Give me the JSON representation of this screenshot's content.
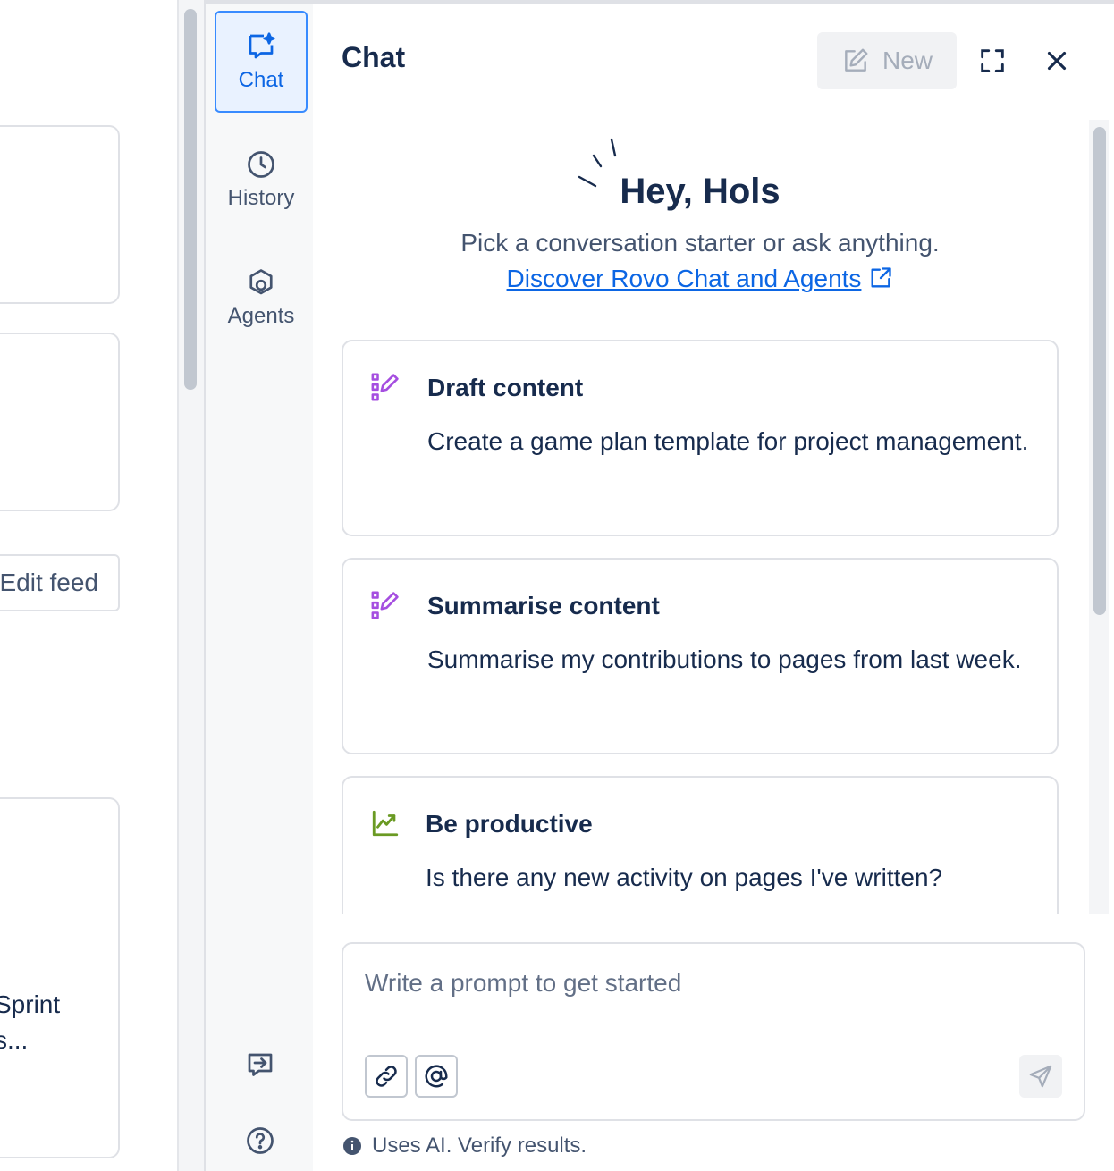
{
  "background": {
    "edit_feed_label": "Edit feed",
    "card_text_line1": "Sprint",
    "card_text_line2": "s..."
  },
  "rail": {
    "items": [
      {
        "label": "Chat",
        "icon": "chat-sparkle-icon",
        "active": true
      },
      {
        "label": "History",
        "icon": "clock-icon",
        "active": false
      },
      {
        "label": "Agents",
        "icon": "agents-icon",
        "active": false
      }
    ],
    "bottom_icons": [
      "switch-to-panel-icon",
      "help-icon"
    ]
  },
  "panel": {
    "title": "Chat",
    "new_button": "New",
    "greeting": "Hey, Hols",
    "subtext": "Pick a conversation starter or ask anything.",
    "discover_link": "Discover Rovo Chat and Agents",
    "starters": [
      {
        "icon": "draft-pencil-icon",
        "title": "Draft content",
        "description": "Create a game plan template for project management."
      },
      {
        "icon": "draft-pencil-icon",
        "title": "Summarise content",
        "description": "Summarise my contributions to pages from last week."
      },
      {
        "icon": "trending-chart-icon",
        "title": "Be productive",
        "description": "Is there any new activity on pages I've written?"
      }
    ],
    "prompt_placeholder": "Write a prompt to get started",
    "disclaimer": "Uses AI. Verify results."
  },
  "colors": {
    "accent": "#0c66e4",
    "active_bg": "#e9f2ff",
    "draft_icon": "#a54ee0",
    "productive_icon": "#6a9a23"
  }
}
